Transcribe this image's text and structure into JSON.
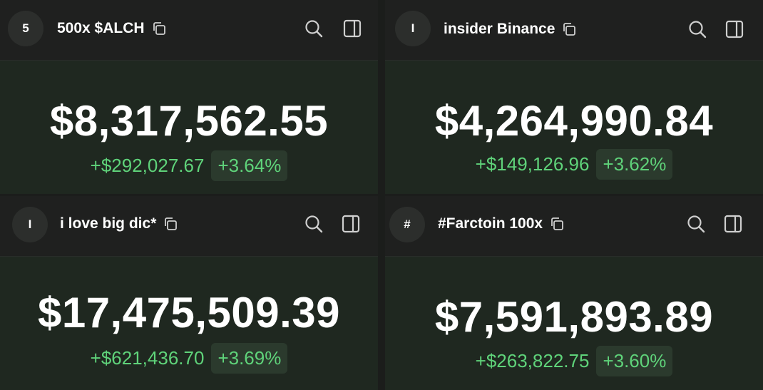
{
  "panels": [
    {
      "avatar": "5",
      "name": "500x $ALCH",
      "value": "$8,317,562.55",
      "change_abs": "+$292,027.67",
      "change_pct": "+3.64%"
    },
    {
      "avatar": "I",
      "name": "insider Binance",
      "value": "$4,264,990.84",
      "change_abs": "+$149,126.96",
      "change_pct": "+3.62%"
    },
    {
      "avatar": "I",
      "name": "i love big dic*",
      "value": "$17,475,509.39",
      "change_abs": "+$621,436.70",
      "change_pct": "+3.69%"
    },
    {
      "avatar": "#",
      "name": "#Farctoin 100x",
      "value": "$7,591,893.89",
      "change_abs": "+$263,822.75",
      "change_pct": "+3.60%"
    }
  ],
  "icons": {
    "copy": "copy-icon",
    "search": "search-icon",
    "panel": "sidebar-panel-icon"
  },
  "colors": {
    "positive": "#5fd37a",
    "badge_bg": "#2b3a2d",
    "header_bg": "#1f201f",
    "body_bg": "#1f2820"
  }
}
